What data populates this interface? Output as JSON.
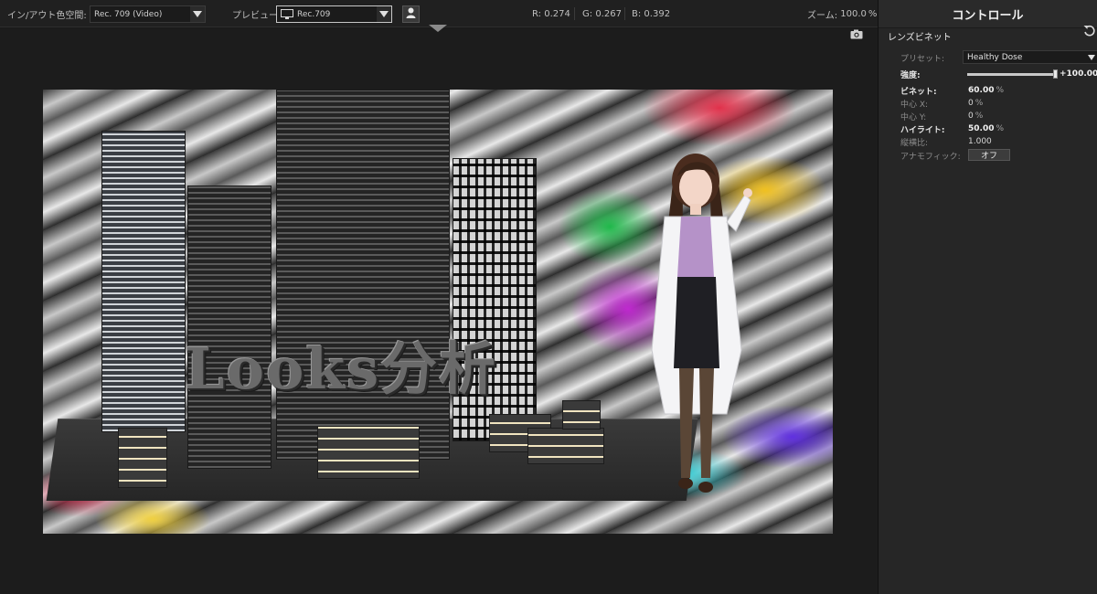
{
  "toolbar": {
    "colorspace_label": "イン/アウト色空間:",
    "colorspace_value": "Rec. 709 (Video)",
    "preview_label": "プレビュー:",
    "preview_value": "Rec.709",
    "r_label": "R:",
    "r_value": "0.274",
    "g_label": "G:",
    "g_value": "0.267",
    "b_label": "B:",
    "b_value": "0.392",
    "zoom_label": "ズーム:",
    "zoom_value": "100.0",
    "zoom_unit": "%"
  },
  "preview": {
    "title_text": "Looks分析"
  },
  "panel": {
    "title": "コントロール",
    "section": "レンズビネット",
    "preset_label": "プリセット:",
    "preset_value": "Healthy Dose",
    "strength_label": "強度:",
    "strength_value": "+100.00",
    "strength_unit": "%",
    "strength_level": 1.0,
    "vignette_label": "ビネット:",
    "vignette_value": "60.00",
    "vignette_unit": "%",
    "center_x_label": "中心 X:",
    "center_x_value": "0",
    "center_x_unit": "%",
    "center_y_label": "中心 Y:",
    "center_y_value": "0",
    "center_y_unit": "%",
    "highlight_label": "ハイライト:",
    "highlight_value": "50.00",
    "highlight_unit": "%",
    "aspect_label": "縦横比:",
    "aspect_value": "1.000",
    "anamorphic_label": "アナモフィック:",
    "anamorphic_value": "オフ"
  },
  "icons": {
    "monitor": "monitor-icon",
    "person": "person-icon",
    "camera": "camera-icon",
    "reset": "reset-icon"
  }
}
